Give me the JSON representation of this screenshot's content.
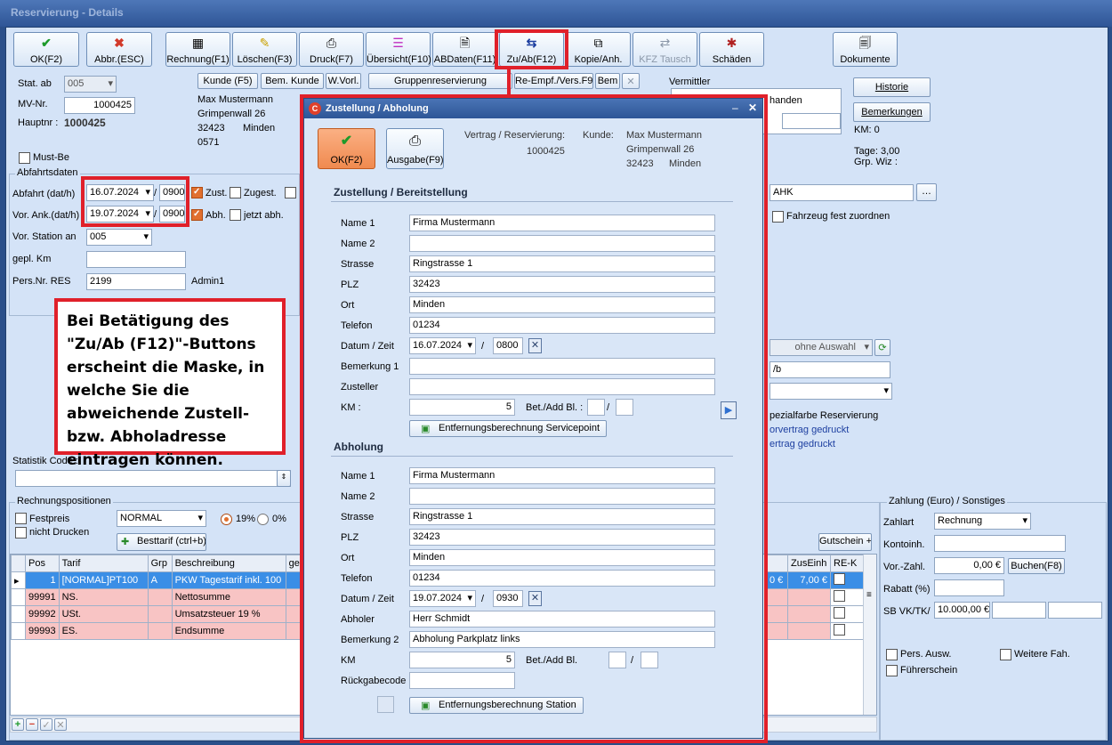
{
  "window": {
    "title": "Reservierung - Details"
  },
  "toolbar": [
    {
      "label": "OK(F2)",
      "icon": "check-icon"
    },
    {
      "label": "Abbr.(ESC)",
      "icon": "cross-icon"
    },
    {
      "label": "Rechnung(F1)",
      "icon": "calculator-icon"
    },
    {
      "label": "Löschen(F3)",
      "icon": "eraser-icon"
    },
    {
      "label": "Druck(F7)",
      "icon": "printer-icon"
    },
    {
      "label": "Übersicht(F10)",
      "icon": "list-icon"
    },
    {
      "label": "ABDaten(F11)",
      "icon": "document-icon"
    },
    {
      "label": "Zu/Ab(F12)",
      "icon": "arrows-icon"
    },
    {
      "label": "Kopie/Anh.",
      "icon": "copy-icon"
    },
    {
      "label": "KFZ Tausch",
      "icon": "car-swap-icon"
    },
    {
      "label": "Schäden",
      "icon": "damage-icon"
    },
    {
      "label": "Dokumente",
      "icon": "documents-icon"
    }
  ],
  "header": {
    "stat_ab_label": "Stat. ab",
    "stat_ab_value": "005",
    "mv_nr_label": "MV-Nr.",
    "mv_nr_value": "1000425",
    "hauptnr_label": "Hauptnr :",
    "hauptnr_value": "1000425",
    "must_be_label": "Must-Be"
  },
  "customer": {
    "kunde_btn": "Kunde (F5)",
    "bem_kunde_btn": "Bem. Kunde",
    "wvorl_btn": "W.Vorl.",
    "name": "Max Mustermann",
    "street": "Grimpenwall 26",
    "zip": "32423",
    "city": "Minden",
    "phone": "0571"
  },
  "midbuttons": {
    "gruppen": "Gruppenreservierung",
    "reempf": "Re-Empf./Vers.F9",
    "bem": "Bem"
  },
  "vermittler": {
    "label": "Vermittler",
    "text": "handen"
  },
  "right": {
    "historie": "Historie",
    "bemerkungen": "Bemerkungen",
    "km": "KM: 0",
    "tage": "Tage: 3,00",
    "grp": "Grp. Wiz :"
  },
  "abfahrt": {
    "title": "Abfahrtsdaten",
    "abfahrt_label": "Abfahrt (dat/h)",
    "abfahrt_date": "16.07.2024",
    "abfahrt_time": "0900",
    "zust_label": "Zust.",
    "zugest_label": "Zugest.",
    "ank_label": "Vor. Ank.(dat/h)",
    "ank_date": "19.07.2024",
    "ank_time": "0900",
    "abh_label": "Abh.",
    "jetzt_label": "jetzt abh.",
    "station_label": "Vor. Station an",
    "station_value": "005",
    "km_label": "gepl. Km",
    "km_value": "",
    "pers_label": "Pers.Nr. RES",
    "pers_value": "2199",
    "pers_name": "Admin1",
    "slash": "/"
  },
  "vehicle": {
    "field": "AHK",
    "fest_label": "Fahrzeug fest zuordnen",
    "ohne": "ohne Auswahl",
    "field2": "/b",
    "spezial": "pezialfarbe Reservierung",
    "vorvertrag": "orvertrag gedruckt",
    "vertrag": "ertrag gedruckt"
  },
  "statistik": {
    "label": "Statistik Code :"
  },
  "callout": {
    "text": "Bei Betätigung des \"Zu/Ab (F12)\"-Buttons erscheint die Maske, in welche Sie die abweichende Zustell- bzw. Abholadresse eintragen können."
  },
  "rechnung": {
    "title": "Rechnungspositionen",
    "festpreis": "Festpreis",
    "nicht_drucken": "nicht Drucken",
    "tarif_select": "NORMAL",
    "vat19": "19%",
    "vat0": "0%",
    "besttarif": "Besttarif (ctrl+b)",
    "gutschein": "Gutschein +",
    "columns": [
      "Pos",
      "Tarif",
      "Grp",
      "Beschreibung",
      "gen"
    ],
    "rows": [
      {
        "pos": "1",
        "tarif": "[NORMAL]PT100",
        "grp": "A",
        "desc": "PKW Tagestarif inkl. 100"
      },
      {
        "pos": "99991",
        "tarif": "NS.",
        "grp": "",
        "desc": "Nettosumme"
      },
      {
        "pos": "99992",
        "tarif": "USt.",
        "grp": "",
        "desc": "Umsatzsteuer 19 %"
      },
      {
        "pos": "99993",
        "tarif": "ES.",
        "grp": "",
        "desc": "Endsumme"
      }
    ],
    "right_cols": [
      "ZusEinh",
      "RE-K"
    ],
    "first_right_a": "0 €",
    "first_right_b": "7,00 €"
  },
  "zahlung": {
    "title": "Zahlung (Euro) / Sonstiges",
    "zahlart_label": "Zahlart",
    "zahlart_value": "Rechnung",
    "konto_label": "Kontoinh.",
    "vorzahl_label": "Vor.-Zahl.",
    "vorzahl_value": "0,00 €",
    "buchen": "Buchen(F8)",
    "rabatt_label": "Rabatt (%)",
    "sb_label": "SB VK/TK/",
    "sb_value": "10.000,00 €",
    "pers_ausw": "Pers. Ausw.",
    "weitere": "Weitere Fah.",
    "fuehrerschein": "Führerschein"
  },
  "dialog": {
    "title": "Zustellung / Abholung",
    "ok": "OK(F2)",
    "ausgabe": "Ausgabe(F9)",
    "vertrag_label": "Vertrag / Reservierung:",
    "vertrag_value": "1000425",
    "kunde_label": "Kunde:",
    "kunde_name": "Max Mustermann",
    "kunde_street": "Grimpenwall 26",
    "kunde_zip": "32423",
    "kunde_city": "Minden",
    "zustellung": {
      "title": "Zustellung / Bereitstellung",
      "name1_label": "Name 1",
      "name1": "Firma Mustermann",
      "name2_label": "Name 2",
      "name2": "",
      "strasse_label": "Strasse",
      "strasse": "Ringstrasse 1",
      "plz_label": "PLZ",
      "plz": "32423",
      "ort_label": "Ort",
      "ort": "Minden",
      "telefon_label": "Telefon",
      "telefon": "01234",
      "datum_label": "Datum / Zeit",
      "datum": "16.07.2024",
      "zeit": "0800",
      "bem1_label": "Bemerkung 1",
      "bem1": "",
      "zusteller_label": "Zusteller",
      "zusteller": "",
      "km_label": "KM :",
      "km": "5",
      "bet_label": "Bet./Add Bl. :",
      "entf_btn": "Entfernungsberechnung Servicepoint"
    },
    "abholung": {
      "title": "Abholung",
      "name1_label": "Name 1",
      "name1": "Firma Mustermann",
      "name2_label": "Name 2",
      "name2": "",
      "strasse_label": "Strasse",
      "strasse": "Ringstrasse 1",
      "plz_label": "PLZ",
      "plz": "32423",
      "ort_label": "Ort",
      "ort": "Minden",
      "telefon_label": "Telefon",
      "telefon": "01234",
      "datum_label": "Datum / Zeit",
      "datum": "19.07.2024",
      "zeit": "0930",
      "abholer_label": "Abholer",
      "abholer": "Herr Schmidt",
      "bem2_label": "Bemerkung 2",
      "bem2": "Abholung Parkplatz links",
      "km_label": "KM",
      "km": "5",
      "bet_label": "Bet./Add Bl.",
      "rueck_label": "Rückgabecode",
      "rueck": "",
      "entf_btn": "Entfernungsberechnung Station"
    },
    "slash": "/"
  },
  "colors": {
    "highlight": "#e0202a",
    "accent": "#e1702f",
    "selection": "#3a8ee6",
    "pink": "#f8c4c4"
  }
}
